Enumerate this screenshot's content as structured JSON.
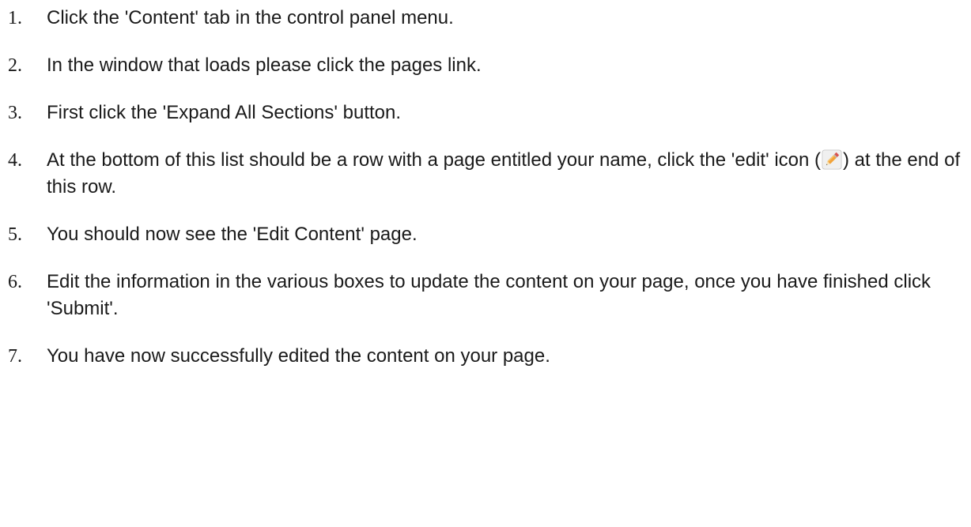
{
  "steps": [
    {
      "number": "1.",
      "text": "Click the 'Content' tab in the control panel menu."
    },
    {
      "number": "2.",
      "text": "In the window that loads please click the pages link."
    },
    {
      "number": "3.",
      "text": "First click the 'Expand All Sections' button."
    },
    {
      "number": "4.",
      "text_before_icon": "At the bottom of this list should be a row with a page entitled your name, click the 'edit' icon (",
      "icon": "pencil-edit-icon",
      "text_after_icon": ") at the end of this row."
    },
    {
      "number": "5.",
      "text": "You should now see the 'Edit Content' page."
    },
    {
      "number": "6.",
      "text": "Edit the information in the various boxes to update the content on your page, once you have finished click 'Submit'."
    },
    {
      "number": "7.",
      "text": "You have now successfully edited the content on your page."
    }
  ],
  "colors": {
    "text": "#1a1a1a",
    "background": "#ffffff",
    "pencil_body": "#f2a33a",
    "pencil_tip": "#f7e3b8",
    "pencil_eraser": "#d9534f"
  }
}
